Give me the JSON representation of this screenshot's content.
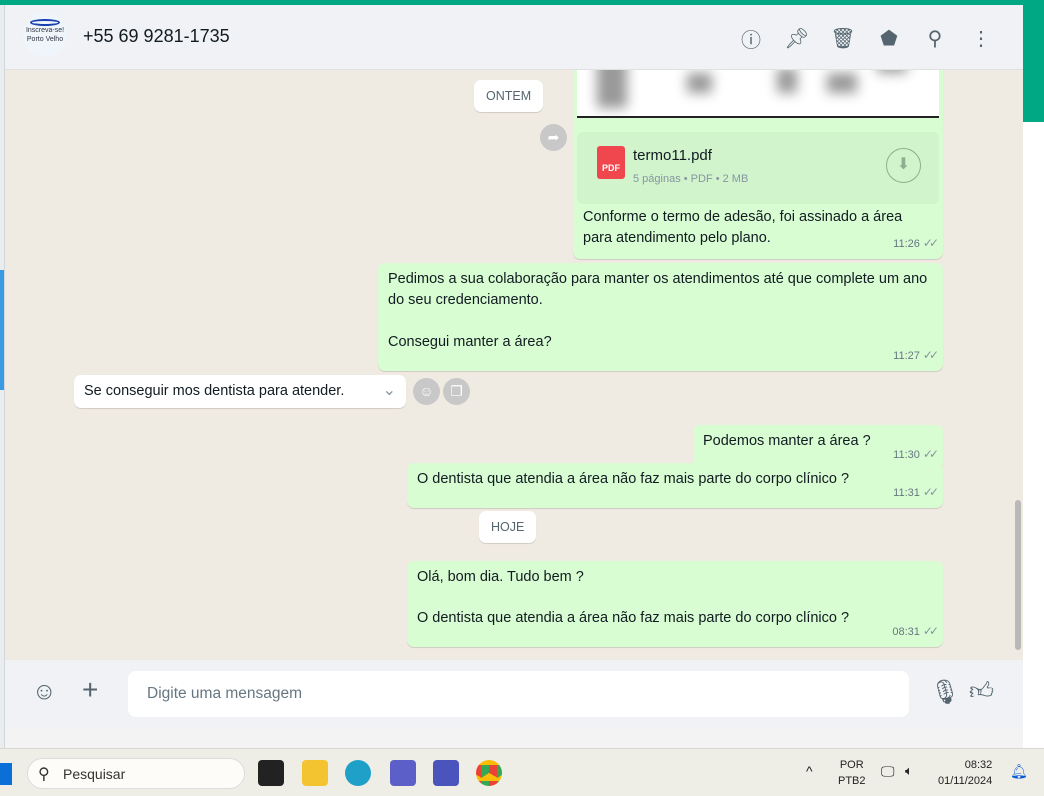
{
  "header": {
    "contact": "+55 69 9281-1735",
    "avatar_text": [
      "Inscreva-se!",
      "Porto Velho"
    ],
    "icons": [
      "info-icon",
      "pin-icon",
      "delete-icon",
      "label-icon",
      "search-icon",
      "menu-icon"
    ]
  },
  "chat": {
    "dates": {
      "yesterday": "ONTEM",
      "today": "HOJE"
    },
    "file": {
      "name": "termo11.pdf",
      "info": "5 páginas • PDF • 2 MB",
      "icon_label": "PDF"
    },
    "messages": [
      {
        "text": "Conforme o termo de adesão, foi assinado a área para atendimento pelo plano.",
        "time": "11:26"
      },
      {
        "text": "Pedimos a sua colaboração para manter os atendimentos até que complete um ano do seu credenciamento.",
        "text2": "Consegui manter a área?",
        "time": "11:27"
      },
      {
        "text": "Se conseguir mos dentista para atender."
      },
      {
        "text": "Podemos manter a área ?",
        "time": "11:30"
      },
      {
        "text": "O dentista que atendia a área não faz mais parte do corpo clínico ?",
        "time": "11:31"
      },
      {
        "text": "Olá, bom dia. Tudo bem ?",
        "text2": "O dentista que atendia a área não faz mais parte do corpo clínico ?",
        "time": "08:31"
      }
    ]
  },
  "footer": {
    "placeholder": "Digite uma mensagem"
  },
  "taskbar": {
    "search": "Pesquisar",
    "lang1": "POR",
    "lang2": "PTB2",
    "time": "08:32",
    "date": "01/11/2024"
  },
  "colors": {
    "accent": "#00a884",
    "outgoing": "#d9fdd3",
    "chat_bg": "#efeae2"
  }
}
